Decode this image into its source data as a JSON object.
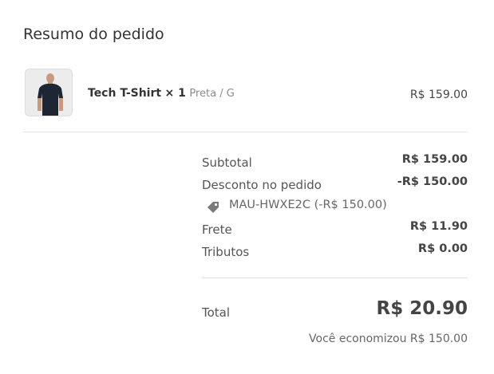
{
  "order_summary": {
    "heading": "Resumo do pedido",
    "item": {
      "name": "Tech T-Shirt",
      "quantity": "× 1",
      "variant": "Preta / G",
      "price": "R$ 159.00",
      "image_icon": "tshirt-model-photo"
    },
    "lines": {
      "subtotal_label": "Subtotal",
      "subtotal_value": "R$ 159.00",
      "discount_label": "Desconto no pedido",
      "discount_value": "-R$ 150.00",
      "coupon_icon": "tag-icon",
      "coupon_code": "MAU-HWXE2C (-R$ 150.00)",
      "shipping_label": "Frete",
      "shipping_value": "R$ 11.90",
      "taxes_label": "Tributos",
      "taxes_value": "R$ 0.00"
    },
    "total": {
      "label": "Total",
      "value": "R$ 20.90",
      "savings": "Você economizou R$ 150.00"
    }
  }
}
